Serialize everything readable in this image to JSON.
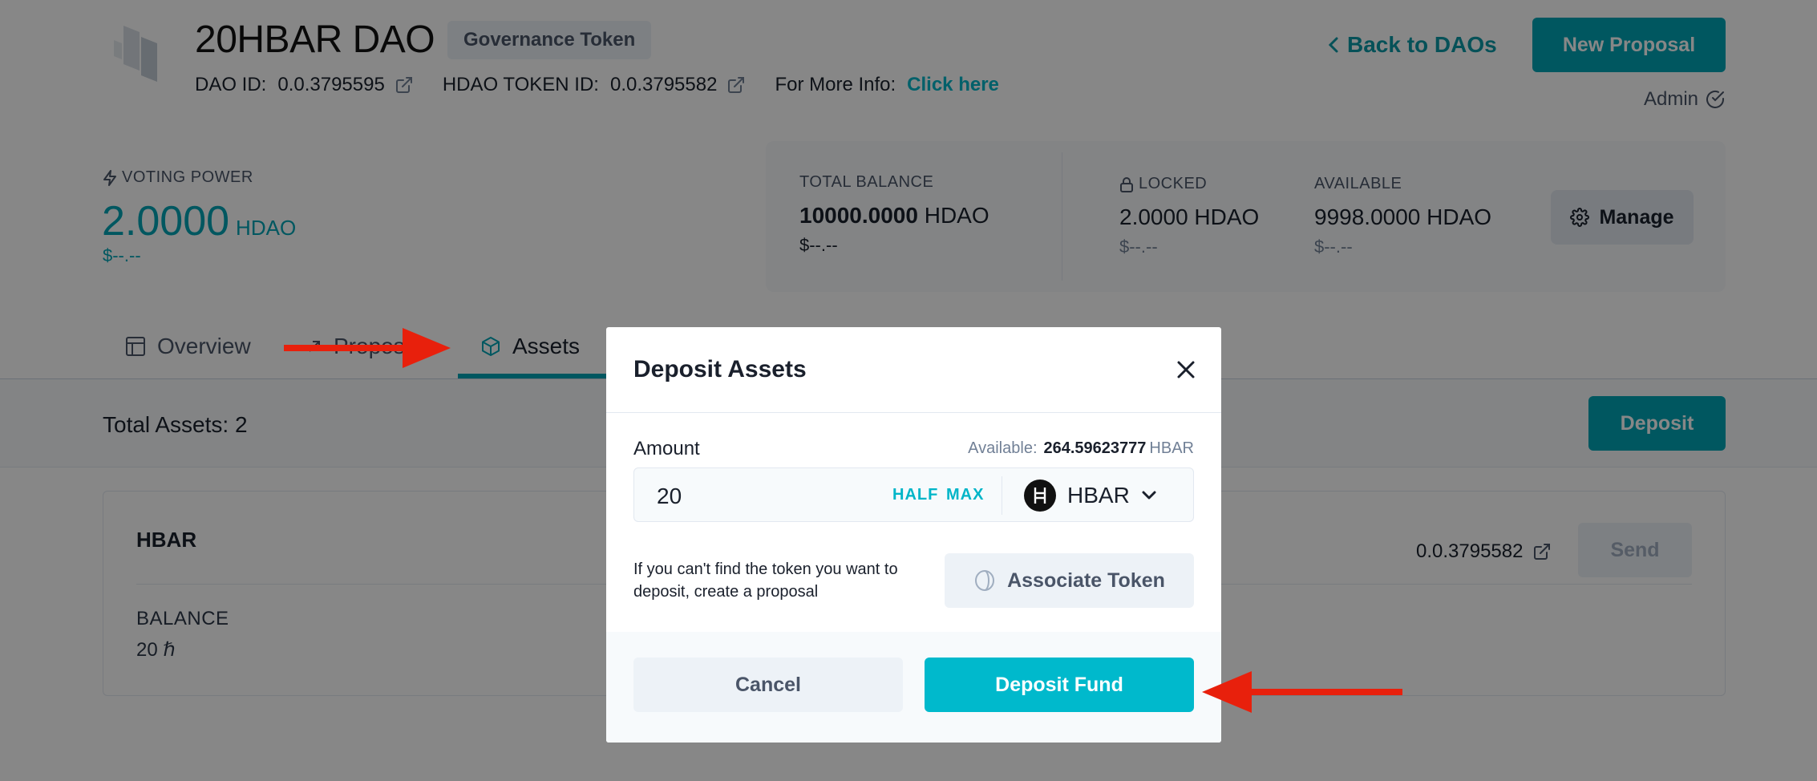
{
  "header": {
    "dao_name": "20HBAR DAO",
    "badge": "Governance Token",
    "dao_id_label": "DAO ID:",
    "dao_id": "0.0.3795595",
    "token_id_label": "HDAO TOKEN ID:",
    "token_id": "0.0.3795582",
    "more_info_label": "For More Info:",
    "more_info_link": "Click here",
    "back_link": "Back to DAOs",
    "new_proposal": "New Proposal",
    "role": "Admin"
  },
  "voting_power": {
    "label": "VOTING POWER",
    "value": "2.0000",
    "unit": "HDAO",
    "usd": "$--.--"
  },
  "balances": {
    "total": {
      "label": "TOTAL BALANCE",
      "value": "10000.0000",
      "unit": "HDAO",
      "usd": "$--.--"
    },
    "locked": {
      "label": "LOCKED",
      "value": "2.0000",
      "unit": "HDAO",
      "usd": "$--.--"
    },
    "available": {
      "label": "AVAILABLE",
      "value": "9998.0000",
      "unit": "HDAO",
      "usd": "$--.--"
    },
    "manage": "Manage"
  },
  "tabs": [
    {
      "label": "Overview",
      "icon": "layout-icon"
    },
    {
      "label": "Propos",
      "icon": "arrow-icon"
    },
    {
      "label": "Assets",
      "icon": "cube-icon"
    }
  ],
  "assets": {
    "total_label": "Total Assets: 2",
    "deposit": "Deposit",
    "card": {
      "name": "HBAR",
      "balance_label": "BALANCE",
      "balance_value": "20 ℏ",
      "token_id": "0.0.3795582",
      "send": "Send"
    }
  },
  "modal": {
    "title": "Deposit Assets",
    "amount_label": "Amount",
    "available_label": "Available:",
    "available_amount": "264.59623777",
    "available_unit": "HBAR",
    "amount_value": "20",
    "half": "HALF",
    "max": "MAX",
    "token": "HBAR",
    "token_symbol": "Ħ",
    "hint": "If you can't find the token you want to deposit, create a proposal",
    "associate": "Associate Token",
    "cancel": "Cancel",
    "deposit_fund": "Deposit Fund"
  },
  "colors": {
    "accent": "#00a5b5",
    "annotation_arrow": "#e8200c"
  }
}
